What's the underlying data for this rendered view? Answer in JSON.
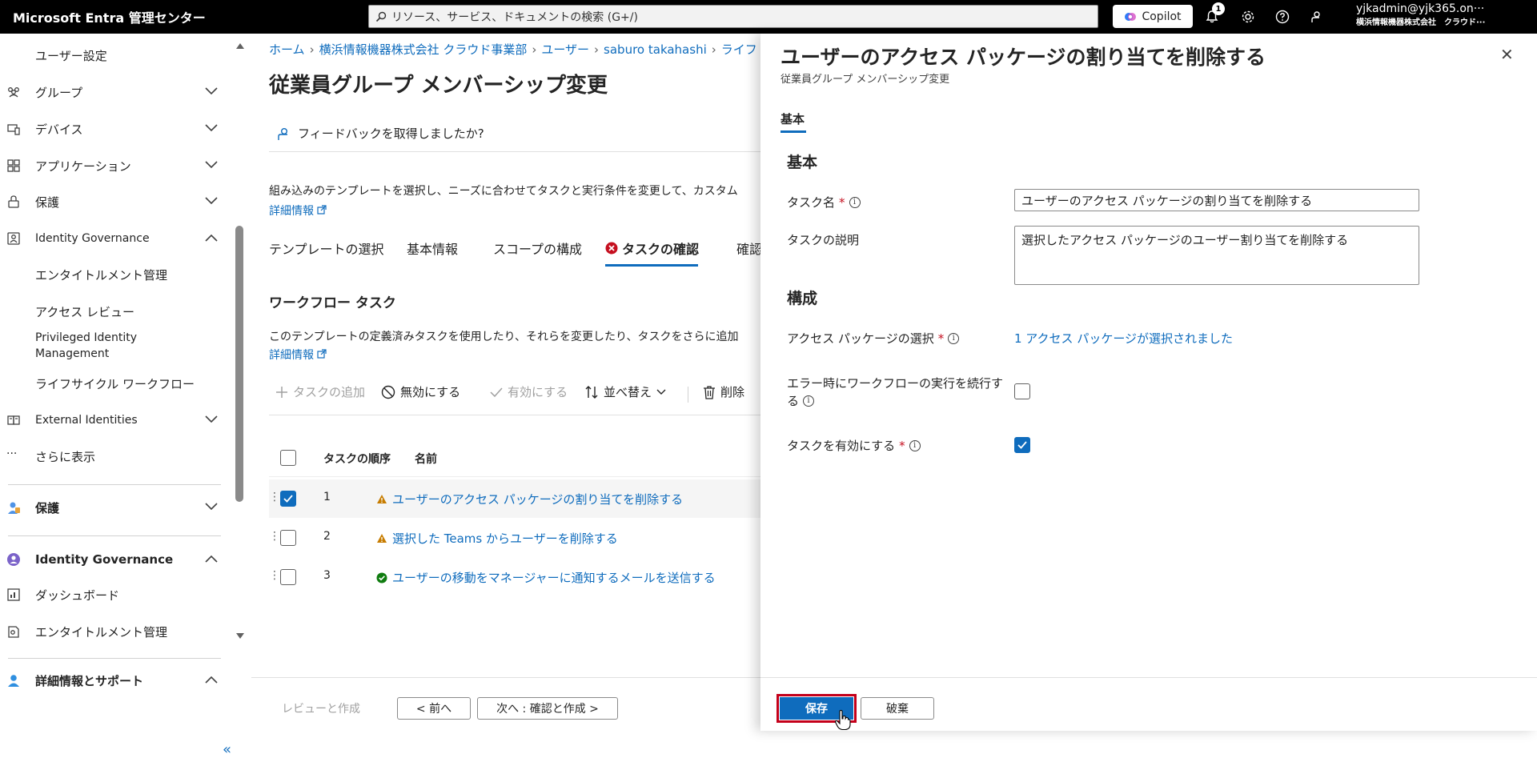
{
  "topbar": {
    "brand": "Microsoft Entra 管理センター",
    "search_placeholder": "リソース、サービス、ドキュメントの検索 (G+/)",
    "copilot_label": "Copilot",
    "notification_count": "1",
    "account_user": "yjkadmin@yjk365.on···",
    "account_tenant": "横浜情報機器株式会社　クラウド···"
  },
  "sidebar": {
    "items": [
      {
        "label": "ユーザー設定"
      },
      {
        "label": "グループ"
      },
      {
        "label": "デバイス"
      },
      {
        "label": "アプリケーション"
      },
      {
        "label": "保護"
      },
      {
        "label": "Identity Governance"
      },
      {
        "label": "エンタイトルメント管理"
      },
      {
        "label": "アクセス レビュー"
      },
      {
        "label": "Privileged Identity"
      },
      {
        "label": "Management"
      },
      {
        "label": "ライフサイクル ワークフロー"
      },
      {
        "label": "External Identities"
      },
      {
        "label": "さらに表示"
      },
      {
        "label": "保護"
      },
      {
        "label": "Identity Governance"
      },
      {
        "label": "ダッシュボード"
      },
      {
        "label": "エンタイトルメント管理"
      },
      {
        "label": "詳細情報とサポート"
      }
    ],
    "more_dots": "···",
    "collapse": "«"
  },
  "main": {
    "breadcrumb": [
      "ホーム",
      "横浜情報機器株式会社 クラウド事業部",
      "ユーザー",
      "saburo takahashi",
      "ライフ"
    ],
    "breadcrumb_sep": "›",
    "title": "従業員グループ メンバーシップ変更",
    "title_more": "···",
    "feedback": "フィードバックを取得しましたか?",
    "description": "組み込みのテンプレートを選択し、ニーズに合わせてタスクと実行条件を変更して、カスタム",
    "learn_more": "詳細情報",
    "steps": [
      "テンプレートの選択",
      "基本情報",
      "スコープの構成",
      "タスクの確認",
      "確認と作"
    ],
    "workflow_title": "ワークフロー タスク",
    "description2": "このテンプレートの定義済みタスクを使用したり、それらを変更したり、タスクをさらに追加",
    "learn_more2": "詳細情報",
    "toolbar": {
      "add": "タスクの追加",
      "disable": "無効にする",
      "enable": "有効にする",
      "sort": "並べ替え",
      "delete": "削除"
    },
    "table": {
      "col_order": "タスクの順序",
      "col_name": "名前",
      "rows": [
        {
          "order": "1",
          "name": "ユーザーのアクセス パッケージの割り当てを削除する",
          "status": "warning",
          "selected": true
        },
        {
          "order": "2",
          "name": "選択した Teams からユーザーを削除する",
          "status": "warning",
          "selected": false
        },
        {
          "order": "3",
          "name": "ユーザーの移動をマネージャーに通知するメールを送信する",
          "status": "ok",
          "selected": false
        }
      ]
    },
    "footer": {
      "review_create": "レビューと作成",
      "prev": "< 前へ",
      "next": "次へ : 確認と作成 >"
    }
  },
  "panel": {
    "title": "ユーザーのアクセス パッケージの割り当てを削除する",
    "subtitle": "従業員グループ メンバーシップ変更",
    "close": "✕",
    "tab": "基本",
    "section_basic": "基本",
    "task_name_label": "タスク名",
    "required_mark": "*",
    "task_name_value": "ユーザーのアクセス パッケージの割り当てを削除する",
    "task_desc_label": "タスクの説明",
    "task_desc_value": "選択したアクセス パッケージのユーザー割り当てを削除する",
    "section_config": "構成",
    "access_pkg_label": "アクセス パッケージの選択",
    "access_pkg_link": "1 アクセス パッケージが選択されました",
    "continue_on_error_label_1": "エラー時にワークフローの実行を続行す",
    "continue_on_error_label_2": "る",
    "continue_on_error_checked": false,
    "enable_task_label": "タスクを有効にする",
    "enable_task_checked": true,
    "save": "保存",
    "discard": "破棄"
  },
  "colors": {
    "accent": "#0f6cbd",
    "warning": "#c77c00",
    "success": "#107c10",
    "error": "#c50f1f",
    "highlight": "#c4001a"
  }
}
